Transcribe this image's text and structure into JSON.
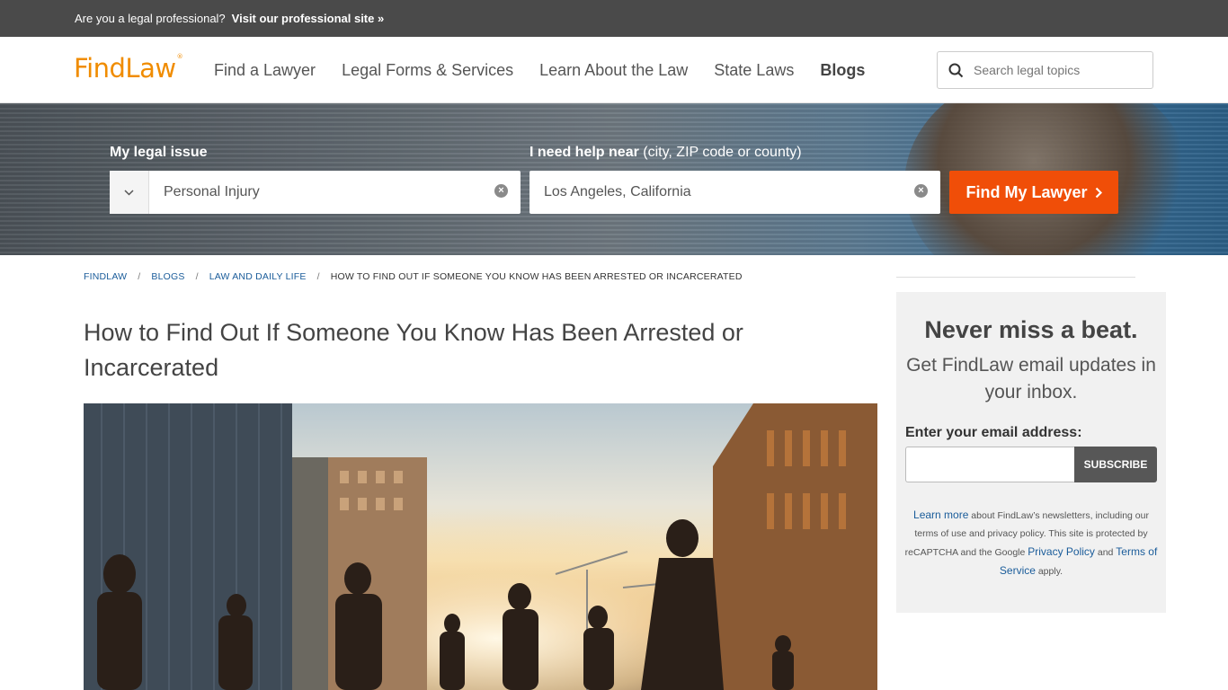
{
  "probar": {
    "question": "Are you a legal professional?",
    "link": "Visit our professional site »"
  },
  "header": {
    "logo": "FindLaw",
    "logo_mark": "®",
    "nav": [
      "Find a Lawyer",
      "Legal Forms & Services",
      "Learn About the Law",
      "State Laws",
      "Blogs"
    ],
    "search_placeholder": "Search legal topics"
  },
  "hero": {
    "issue_label": "My legal issue",
    "near_label_bold": "I need help near",
    "near_label_rest": " (city, ZIP code or county)",
    "issue_value": "Personal Injury",
    "location_value": "Los Angeles, California",
    "button": "Find My Lawyer"
  },
  "breadcrumb": [
    "FINDLAW",
    "BLOGS",
    "LAW AND DAILY LIFE",
    "HOW TO FIND OUT IF SOMEONE YOU KNOW HAS BEEN ARRESTED OR INCARCERATED"
  ],
  "article": {
    "title": "How to Find Out If Someone You Know Has Been Arrested or Incarcerated"
  },
  "signup": {
    "heading": "Never miss a beat.",
    "sub": "Get FindLaw email updates in your inbox.",
    "email_label": "Enter your email address:",
    "button": "SUBSCRIBE",
    "learn_more": "Learn more",
    "fine_1": " about FindLaw’s newsletters, including our terms of use and privacy policy. This site is protected by reCAPTCHA and the Google ",
    "privacy": "Privacy Policy",
    "and": " and ",
    "terms": "Terms of Service",
    "apply": " apply."
  },
  "colors": {
    "brand": "#f08c00",
    "cta": "#f04e08",
    "link": "#1a5c9a"
  }
}
